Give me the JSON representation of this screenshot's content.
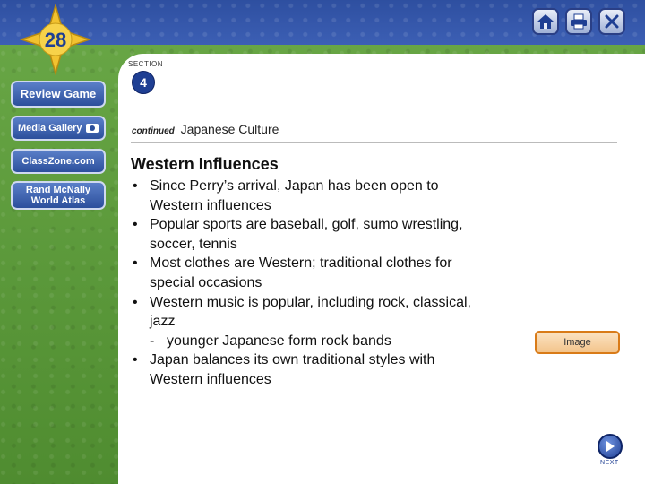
{
  "chapter_number": "28",
  "sidebar": {
    "items": [
      {
        "label": "Review Game"
      },
      {
        "label": "Media Gallery"
      },
      {
        "label": "ClassZone.com"
      },
      {
        "label_line1": "Rand McNally",
        "label_line2": "World Atlas"
      }
    ]
  },
  "toolbar": {
    "icons": [
      "home-icon",
      "print-icon",
      "close-icon"
    ]
  },
  "section": {
    "label": "SECTION",
    "number": "4"
  },
  "subtitle": {
    "prefix": "continued",
    "title": "Japanese Culture"
  },
  "heading": "Western Influences",
  "bullets": [
    {
      "marker": "•",
      "lines": [
        "Since Perry’s arrival, Japan has been open to",
        "Western influences"
      ]
    },
    {
      "marker": "•",
      "lines": [
        "Popular sports are baseball, golf, sumo wrestling,",
        "soccer, tennis"
      ]
    },
    {
      "marker": "•",
      "lines": [
        "Most clothes are Western; traditional clothes for",
        "special occasions"
      ]
    },
    {
      "marker": "•",
      "lines": [
        "Western music is popular, including rock, classical,",
        "jazz"
      ]
    },
    {
      "marker": "-",
      "lines": [
        "younger Japanese form rock bands"
      ]
    },
    {
      "marker": "•",
      "lines": [
        "Japan balances its own traditional styles with",
        "Western influences"
      ]
    }
  ],
  "image_button": {
    "label": "Image"
  },
  "next": {
    "label": "NEXT"
  },
  "colors": {
    "accent_blue": "#1f3f93",
    "panel": "#ffffff",
    "green": "#5b9a3a",
    "orange": "#d97b18"
  }
}
